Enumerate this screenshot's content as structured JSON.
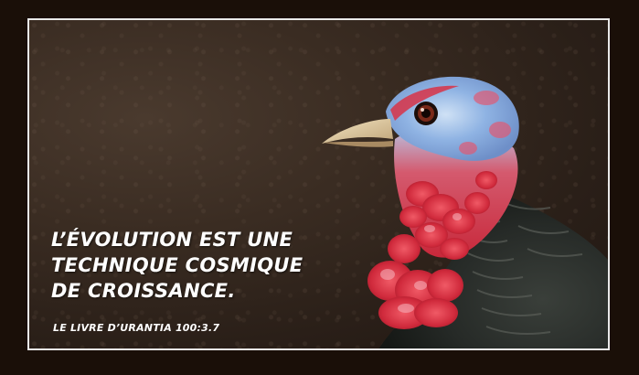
{
  "quote": {
    "line1": "L’ÉVOLUTION EST UNE",
    "line2": "TECHNIQUE COSMIQUE",
    "line3": "DE CROISSANCE."
  },
  "source": "LE LIVRE D’URANTIA  100:3.7",
  "colors": {
    "outer_background": "#1a0f08",
    "frame_border": "#e9e9e9",
    "text": "#ffffff"
  }
}
